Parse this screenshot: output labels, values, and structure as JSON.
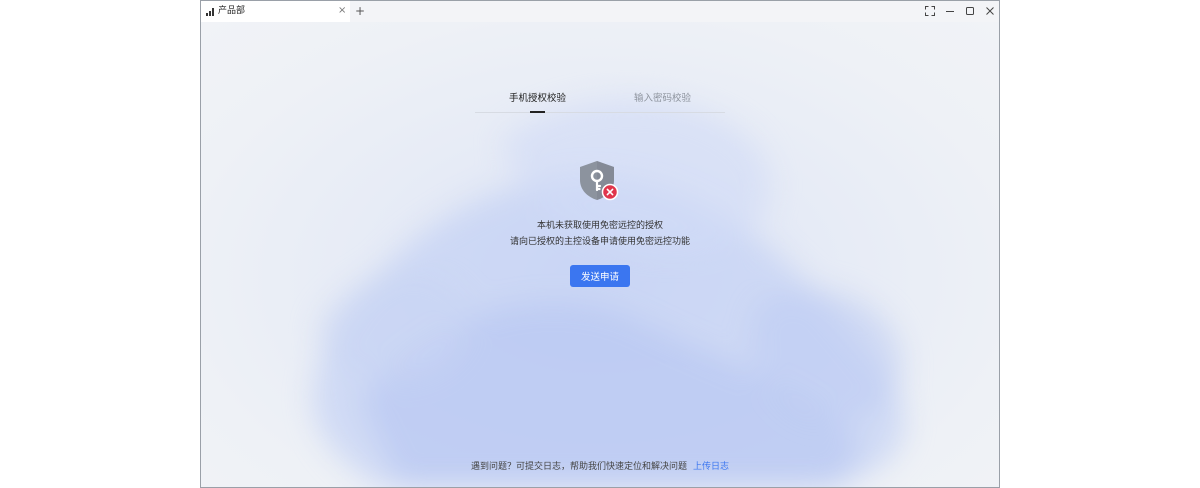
{
  "window": {
    "tab_title": "产品部",
    "tab_close": "×",
    "add_tab": "+"
  },
  "auth_tabs": [
    {
      "label": "手机授权校验",
      "active": true
    },
    {
      "label": "输入密码校验",
      "active": false
    }
  ],
  "status": {
    "icon": "shield-key-error-icon",
    "line1": "本机未获取使用免密远控的授权",
    "line2": "请向已授权的主控设备申请使用免密远控功能"
  },
  "actions": {
    "send_request": "发送申请"
  },
  "footer": {
    "help_text": "遇到问题？可提交日志，帮助我们快速定位和解决问题",
    "upload_log": "上传日志"
  },
  "colors": {
    "accent": "#3b76f0",
    "error": "#e0354c",
    "shield": "#8c939e"
  }
}
